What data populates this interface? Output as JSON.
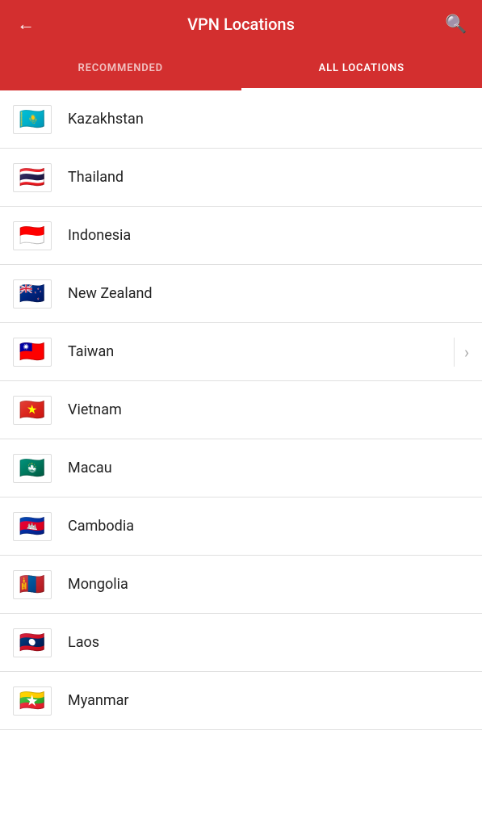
{
  "header": {
    "title": "VPN Locations",
    "back_label": "←",
    "search_label": "🔍"
  },
  "tabs": [
    {
      "id": "recommended",
      "label": "RECOMMENDED",
      "active": false
    },
    {
      "id": "all_locations",
      "label": "ALL LOCATIONS",
      "active": true
    }
  ],
  "locations": [
    {
      "id": "kazakhstan",
      "name": "Kazakhstan",
      "flag_emoji": "🇰🇿",
      "flag_class": "flag-kz",
      "has_submenu": false
    },
    {
      "id": "thailand",
      "name": "Thailand",
      "flag_emoji": "🇹🇭",
      "flag_class": "flag-th",
      "has_submenu": false
    },
    {
      "id": "indonesia",
      "name": "Indonesia",
      "flag_emoji": "🇮🇩",
      "flag_class": "flag-id",
      "has_submenu": false
    },
    {
      "id": "new_zealand",
      "name": "New Zealand",
      "flag_emoji": "🇳🇿",
      "flag_class": "flag-nz",
      "has_submenu": false
    },
    {
      "id": "taiwan",
      "name": "Taiwan",
      "flag_emoji": "🇹🇼",
      "flag_class": "flag-tw",
      "has_submenu": true
    },
    {
      "id": "vietnam",
      "name": "Vietnam",
      "flag_emoji": "🇻🇳",
      "flag_class": "flag-vn",
      "has_submenu": false
    },
    {
      "id": "macau",
      "name": "Macau",
      "flag_emoji": "🇲🇴",
      "flag_class": "flag-mo",
      "has_submenu": false
    },
    {
      "id": "cambodia",
      "name": "Cambodia",
      "flag_emoji": "🇰🇭",
      "flag_class": "flag-kh",
      "has_submenu": false
    },
    {
      "id": "mongolia",
      "name": "Mongolia",
      "flag_emoji": "🇲🇳",
      "flag_class": "flag-mn",
      "has_submenu": false
    },
    {
      "id": "laos",
      "name": "Laos",
      "flag_emoji": "🇱🇦",
      "flag_class": "flag-la",
      "has_submenu": false
    },
    {
      "id": "myanmar",
      "name": "Myanmar",
      "flag_emoji": "🇲🇲",
      "flag_class": "flag-mm",
      "has_submenu": false
    }
  ],
  "chevron_symbol": "›"
}
